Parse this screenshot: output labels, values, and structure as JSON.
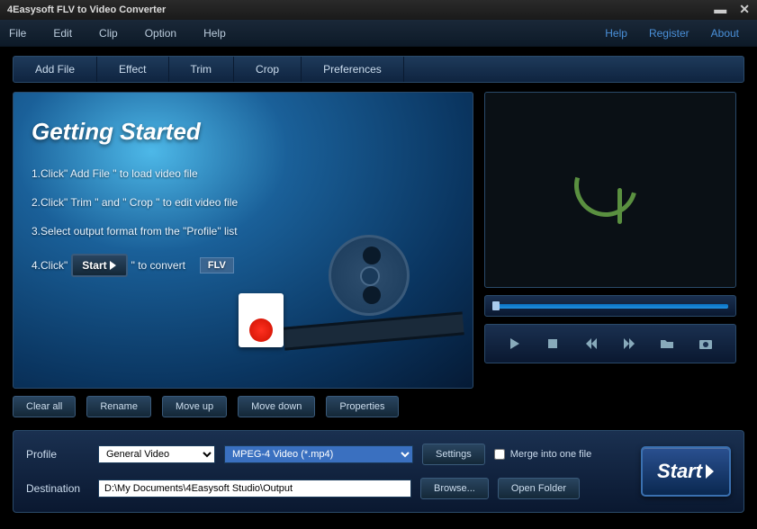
{
  "titlebar": {
    "title": "4Easysoft FLV to Video Converter"
  },
  "menubar": {
    "left": [
      "File",
      "Edit",
      "Clip",
      "Option",
      "Help"
    ],
    "right": [
      "Help",
      "Register",
      "About"
    ]
  },
  "toolbar": {
    "items": [
      "Add File",
      "Effect",
      "Trim",
      "Crop",
      "Preferences"
    ]
  },
  "getting_started": {
    "title": "Getting Started",
    "step1": "1.Click\" Add File \" to load video file",
    "step2": "2.Click\" Trim \" and \" Crop \" to edit video file",
    "step3": "3.Select output format from the \"Profile\" list",
    "step4_a": "4.Click\"",
    "step4_btn": "Start",
    "step4_b": "\" to convert",
    "flv_badge": "FLV"
  },
  "row_buttons": {
    "clear_all": "Clear all",
    "rename": "Rename",
    "move_up": "Move up",
    "move_down": "Move down",
    "properties": "Properties"
  },
  "bottom": {
    "profile_label": "Profile",
    "profile_category": "General Video",
    "profile_format": "MPEG-4 Video (*.mp4)",
    "settings_btn": "Settings",
    "merge_label": "Merge into one file",
    "destination_label": "Destination",
    "destination_value": "D:\\My Documents\\4Easysoft Studio\\Output",
    "browse_btn": "Browse...",
    "open_folder_btn": "Open Folder",
    "start_btn": "Start"
  }
}
